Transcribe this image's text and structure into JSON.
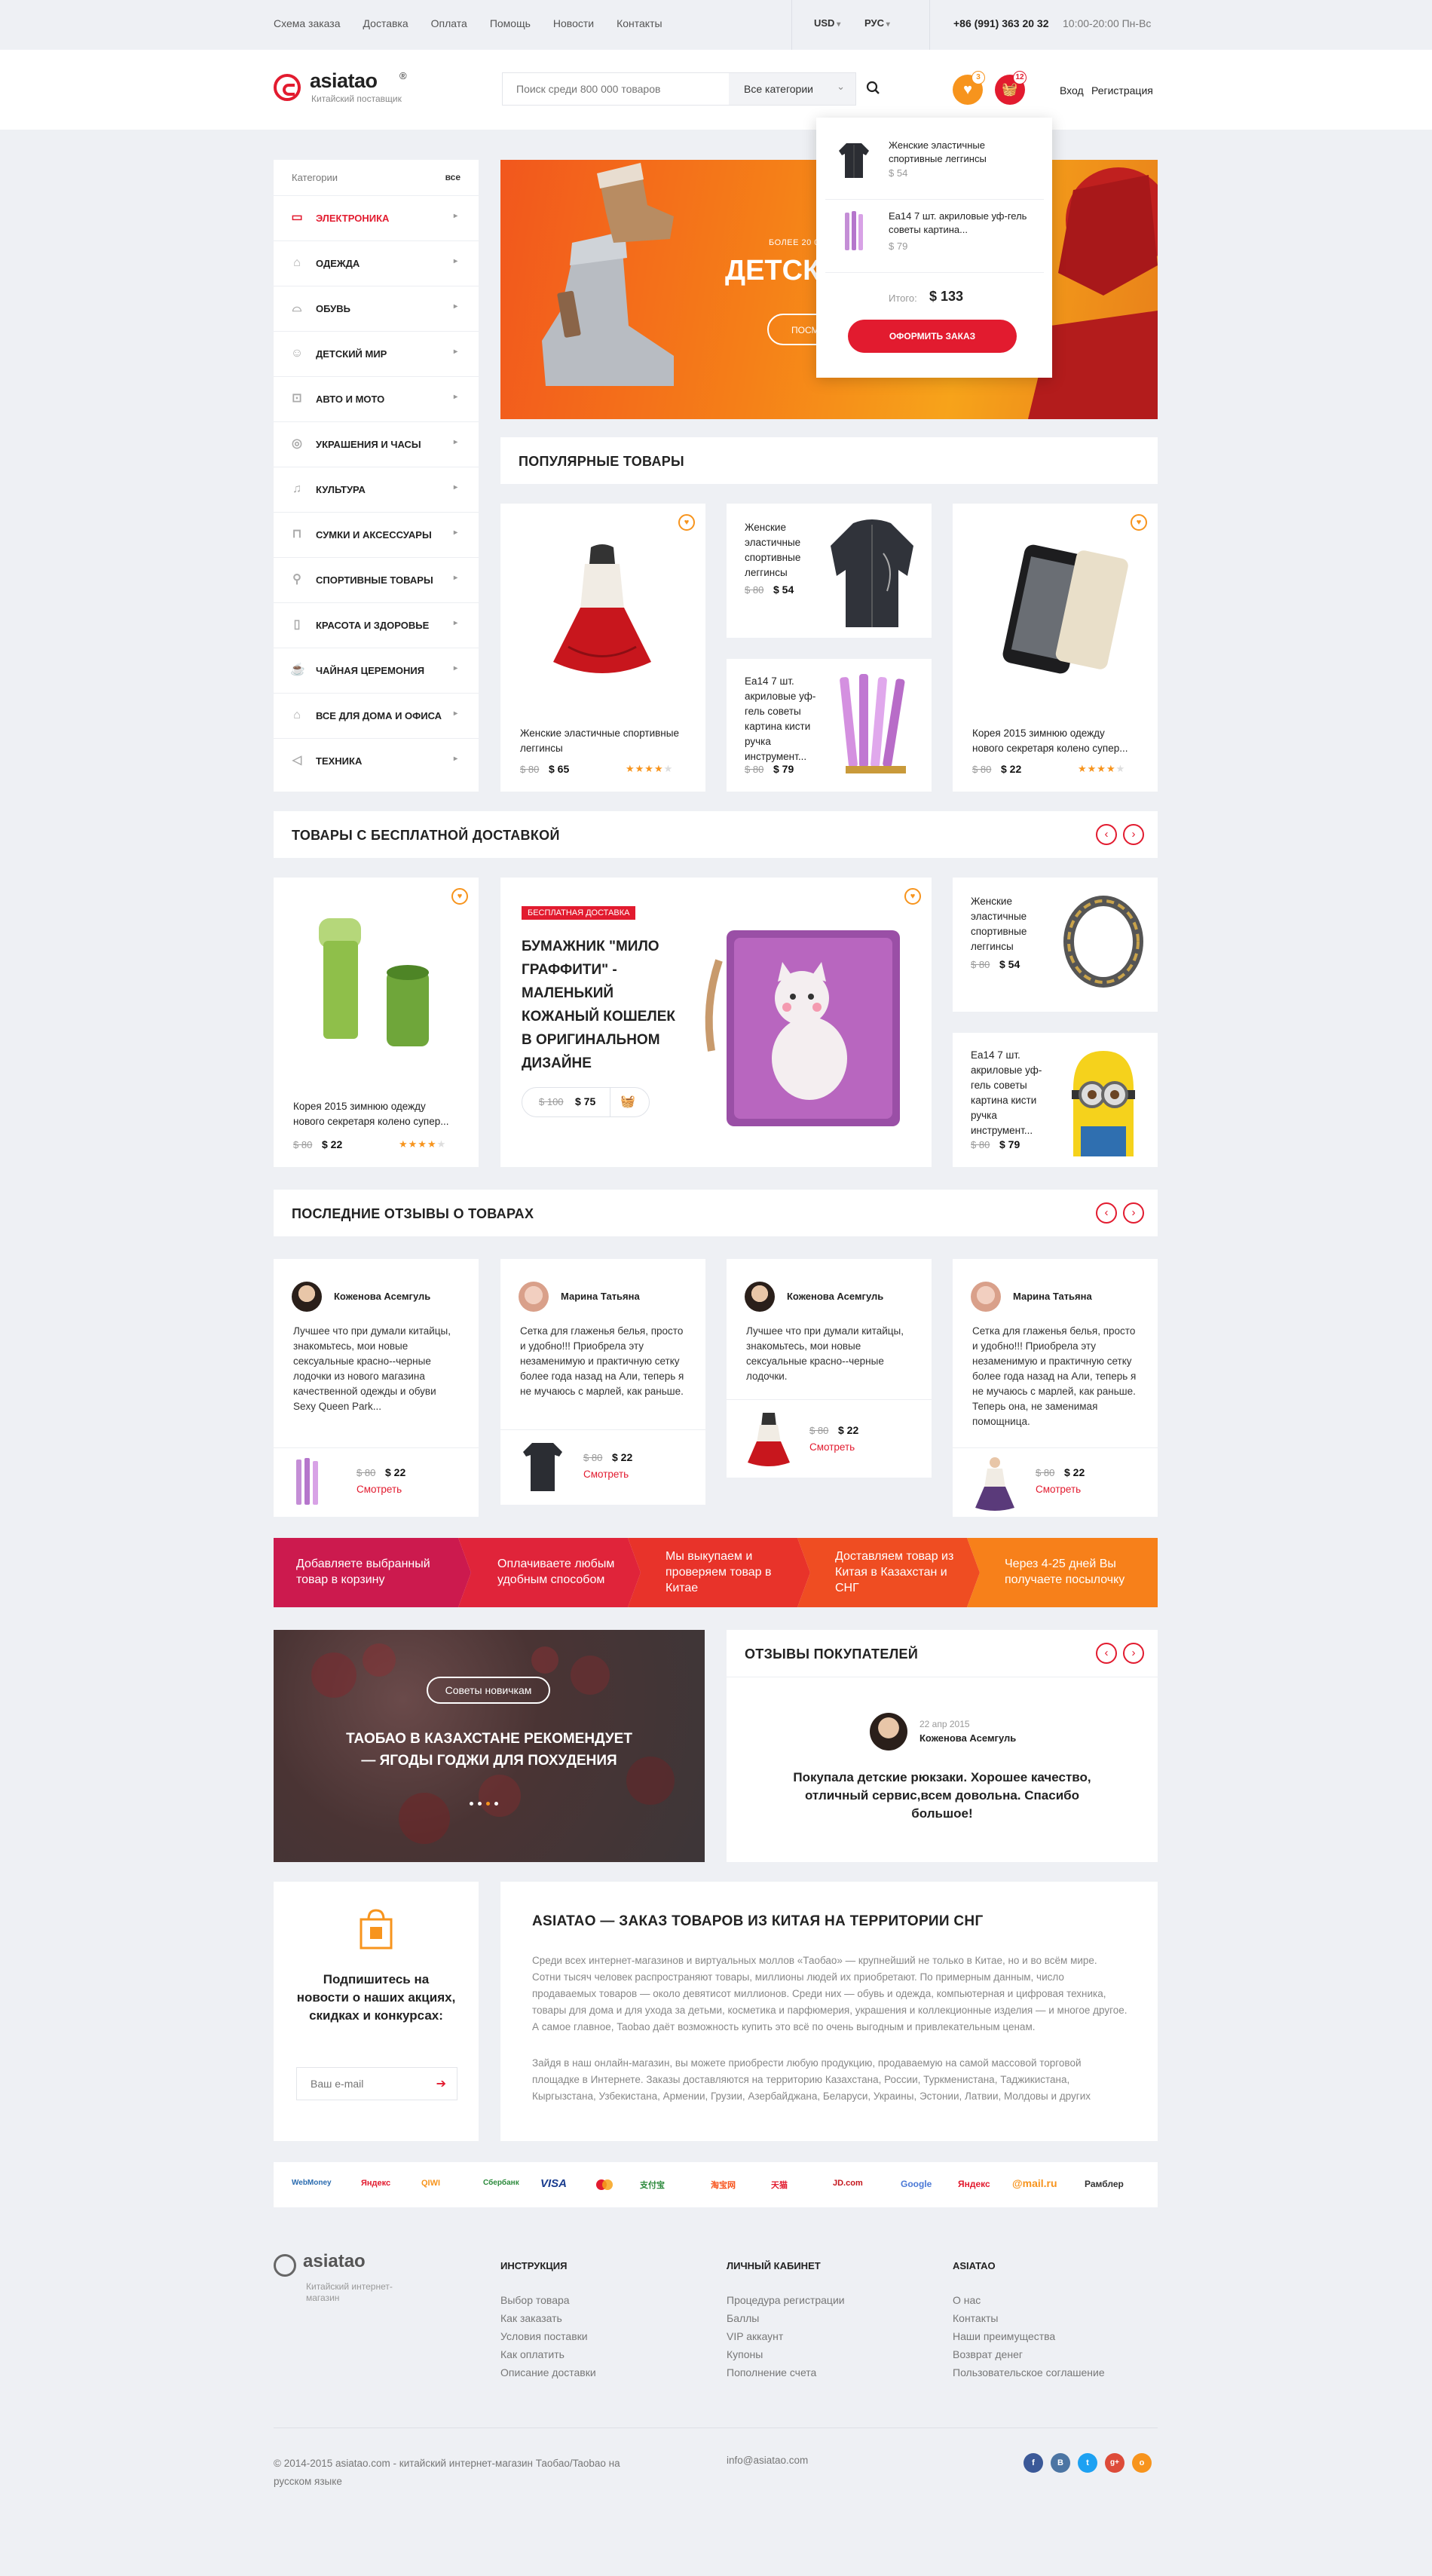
{
  "topnav": {
    "items": [
      "Схема заказа",
      "Доставка",
      "Оплата",
      "Помощь",
      "Новости",
      "Контакты"
    ],
    "currency": "USD",
    "language": "РУС",
    "phone": "+86 (991) 363 20 32",
    "hours": "10:00-20:00 Пн-Вс"
  },
  "header": {
    "logo": "asiatao",
    "logo_sup": "®",
    "tagline": "Китайский поставщик",
    "search_placeholder": "Поиск среди 800 000 товаров",
    "search_category": "Все категории",
    "wishlist_count": "3",
    "cart_count": "12",
    "login": "Вход",
    "register": "Регистрация"
  },
  "sidebar": {
    "title": "Категории",
    "all": "все",
    "items": [
      {
        "label": "Электроника",
        "icon": "monitor-icon"
      },
      {
        "label": "Одежда",
        "icon": "dress-icon"
      },
      {
        "label": "Обувь",
        "icon": "shoe-icon"
      },
      {
        "label": "Детский мир",
        "icon": "baby-icon"
      },
      {
        "label": "Авто и мото",
        "icon": "car-icon"
      },
      {
        "label": "Украшения и часы",
        "icon": "ring-icon"
      },
      {
        "label": "Культура",
        "icon": "music-icon"
      },
      {
        "label": "Сумки и аксессуары",
        "icon": "bag-icon"
      },
      {
        "label": "Спортивные товары",
        "icon": "bike-icon"
      },
      {
        "label": "Красота и здоровье",
        "icon": "lipstick-icon"
      },
      {
        "label": "Чайная церемония",
        "icon": "tea-icon"
      },
      {
        "label": "Все для дома и офиса",
        "icon": "home-icon"
      },
      {
        "label": "Техника",
        "icon": "tech-icon"
      }
    ]
  },
  "banner": {
    "pre": "Более 20 000 тов",
    "title": "ДЕТСК",
    "button": "Посм"
  },
  "cart": {
    "items": [
      {
        "name": "Женские эластичные спортивные леггинсы",
        "price": "$ 54"
      },
      {
        "name": "Ea14 7 шт. акриловые уф-гель советы картина...",
        "price": "$ 79"
      }
    ],
    "total_label": "Итого:",
    "total": "$ 133",
    "checkout": "Оформить заказ"
  },
  "popular": {
    "title": "Популярные товары",
    "items": [
      {
        "name": "Женские эластичные спортивные леггинсы",
        "old": "$ 80",
        "price": "$ 65"
      },
      {
        "name": "Женские эластичные спортивные леггинсы",
        "old": "$ 80",
        "price": "$ 54"
      },
      {
        "name": "Ea14 7 шт. акриловые уф-гель советы картина кисти ручка инструмент...",
        "old": "$ 80",
        "price": "$ 79"
      },
      {
        "name": "Корея 2015 зимнюю одежду нового секретаря колено супер...",
        "old": "$ 80",
        "price": "$ 22"
      }
    ]
  },
  "free": {
    "title": "Товары с бесплатной доставкой",
    "left": {
      "name": "Корея 2015 зимнюю одежду нового секретаря колено супер...",
      "old": "$ 80",
      "price": "$ 22"
    },
    "featured": {
      "badge": "Бесплатная доставка",
      "title": "Бумажник \"Мило Граффити\" - маленький кожаный кошелек в оригинальном дизайне",
      "old": "$ 100",
      "price": "$ 75"
    },
    "right": [
      {
        "name": "Женские эластичные спортивные леггинсы",
        "old": "$ 80",
        "price": "$ 54"
      },
      {
        "name": "Ea14 7 шт. акриловые уф-гель советы картина кисти ручка инструмент...",
        "old": "$ 80",
        "price": "$ 79"
      }
    ]
  },
  "reviews": {
    "title": "Последние отзывы о товарах",
    "see": "Смотреть",
    "items": [
      {
        "name": "Коженова Асемгуль",
        "text": "Лучшее что при думали китайцы, знакомьтесь, мои новые сексуальные красно--черные лодочки из нового магазина качественной одежды и обуви Sexy Queen Park...",
        "old": "$ 80",
        "price": "$ 22"
      },
      {
        "name": "Марина Татьяна",
        "text": "Сетка для глаженья белья, просто и удобно!!! Приобрела эту незаменимую и практичную сетку более года назад на Али, теперь я не мучаюсь с марлей, как раньше.",
        "old": "$ 80",
        "price": "$ 22"
      },
      {
        "name": "Коженова Асемгуль",
        "text": "Лучшее что при думали китайцы, знакомьтесь, мои новые сексуальные красно--черные лодочки.",
        "old": "$ 80",
        "price": "$ 22"
      },
      {
        "name": "Марина Татьяна",
        "text": "Сетка для глаженья белья, просто и удобно!!! Приобрела эту незаменимую и практичную сетку более года назад на Али, теперь я не мучаюсь с марлей, как раньше. Теперь она, не заменимая помощница.",
        "old": "$ 80",
        "price": "$ 22"
      }
    ]
  },
  "steps": [
    "Добавляете выбранный товар в корзину",
    "Оплачиваете любым удобным способом",
    "Мы выкупаем и проверяем товар в Китае",
    "Доставляем товар из Китая в Казахстан и СНГ",
    "Через 4-25 дней Вы получаете посылочку"
  ],
  "blog": {
    "tag": "Советы новичкам",
    "title": "ТАОБАО В КАЗАХСТАНЕ РЕКОМЕНДУЕТ — ЯГОДЫ ГОДЖИ ДЛЯ ПОХУДЕНИЯ"
  },
  "testimonials": {
    "title": "Отзывы покупателей",
    "date": "22 апр 2015",
    "name": "Коженова Асемгуль",
    "text": "Покупала детские рюкзаки. Хорошее  качество, отличный сервис,всем довольна. Спасибо большое!"
  },
  "subscribe": {
    "title": "Подпишитесь на новости о наших акциях, скидках и конкурсах:",
    "placeholder": "Ваш e-mail"
  },
  "about": {
    "title": "ASIATAO — заказ товаров из Китая на территории СНГ",
    "p1": "Среди всех интернет-магазинов и виртуальных моллов «Таобао» — крупнейший не только в Китае, но и во всём мире. Сотни тысяч человек распространяют товары, миллионы людей их приобретают. По примерным данным, число продаваемых товаров — около девятисот миллионов. Среди них — обувь и одежда, компьютерная и цифровая техника, товары для дома и для ухода за детьми, косметика и парфюмерия, украшения и коллекционные изделия — и многое другое. А самое главное, Taobao даёт возможность купить это всё по очень выгодным и привлекательным ценам.",
    "p2": "Зайдя в наш онлайн-магазин, вы можете приобрести любую продукцию, продаваемую на самой массовой торговой площадке в Интернете. Заказы доставляются на территорию Казахстана, России, Туркменистана, Таджикистана, Кыргызстана, Узбекистана, Армении, Грузии, Азербайджана, Беларуси, Украины, Эстонии, Латвии, Молдовы и других"
  },
  "payments": [
    "WebMoney",
    "Яндекс",
    "QIWI",
    "Сбербанк",
    "VISA",
    "MasterCard",
    "支付宝",
    "淘宝网",
    "天猫",
    "JD.com",
    "Google",
    "Яндекс",
    "@mail.ru",
    "Рамблер"
  ],
  "footer": {
    "logo": "asiatao",
    "tagline": "Китайский интернет-магазин",
    "cols": [
      {
        "title": "Инструкция",
        "links": [
          "Выбор товара",
          "Как заказать",
          "Условия поставки",
          "Как оплатить",
          "Описание доставки"
        ]
      },
      {
        "title": "Личный кабинет",
        "links": [
          "Процедура регистрации",
          "Баллы",
          "VIP аккаунт",
          "Купоны",
          "Пополнение счета"
        ]
      },
      {
        "title": "ASIATAO",
        "links": [
          "О нас",
          "Контакты",
          "Наши преимущества",
          "Возврат денег",
          "Пользовательское соглашение"
        ]
      }
    ],
    "copyright": "© 2014-2015 asiatao.com - китайский интернет-магазин Таобао/Taobao на русском языке",
    "email": "info@asiatao.com",
    "social": [
      "f",
      "В",
      "t",
      "g+",
      "o"
    ]
  },
  "colors": {
    "accent": "#e21b2f",
    "orange": "#f7941d",
    "steps": [
      "#cc1a4e",
      "#e0243a",
      "#e8332a",
      "#ef4d22",
      "#f7801a"
    ]
  }
}
